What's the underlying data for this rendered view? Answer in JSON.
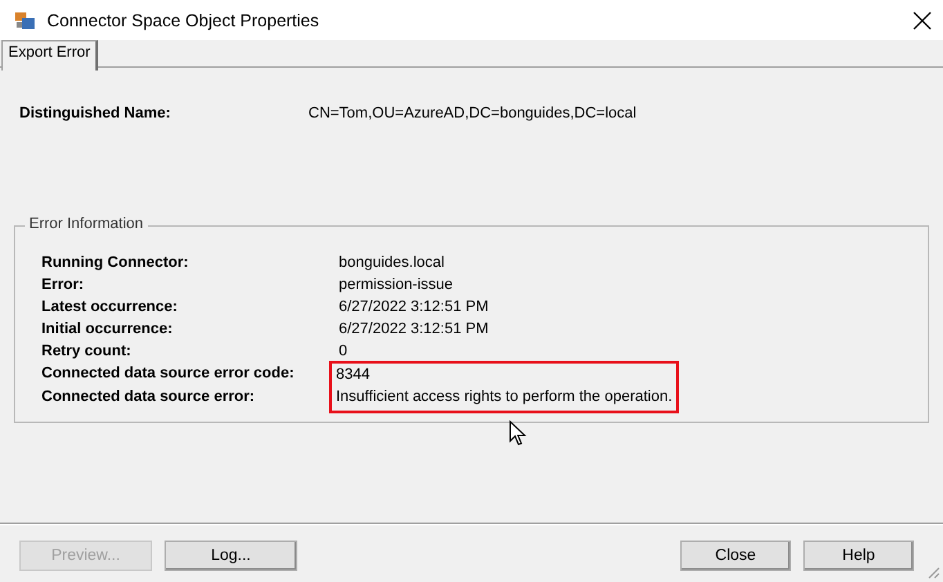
{
  "window": {
    "title": "Connector Space Object Properties"
  },
  "tabs": [
    {
      "label": "Export Error",
      "selected": true
    }
  ],
  "distinguished_name": {
    "label": "Distinguished Name:",
    "value": "CN=Tom,OU=AzureAD,DC=bonguides,DC=local"
  },
  "error_information": {
    "title": "Error Information",
    "rows": [
      {
        "label": "Running Connector:",
        "value": "bonguides.local",
        "highlighted": false
      },
      {
        "label": "Error:",
        "value": "permission-issue",
        "highlighted": false
      },
      {
        "label": "Latest occurrence:",
        "value": "6/27/2022 3:12:51 PM",
        "highlighted": false
      },
      {
        "label": "Initial occurrence:",
        "value": "6/27/2022 3:12:51 PM",
        "highlighted": false
      },
      {
        "label": "Retry count:",
        "value": "0",
        "highlighted": false
      },
      {
        "label": "Connected data source error code:",
        "value": "8344",
        "highlighted": true
      },
      {
        "label": "Connected data source error:",
        "value": "Insufficient access rights to perform the operation.",
        "highlighted": true
      }
    ]
  },
  "buttons_left": [
    {
      "label": "Preview...",
      "disabled": true
    },
    {
      "label": "Log...",
      "disabled": false
    }
  ],
  "buttons_right": [
    {
      "label": "Close",
      "disabled": false
    },
    {
      "label": "Help",
      "disabled": false
    }
  ]
}
